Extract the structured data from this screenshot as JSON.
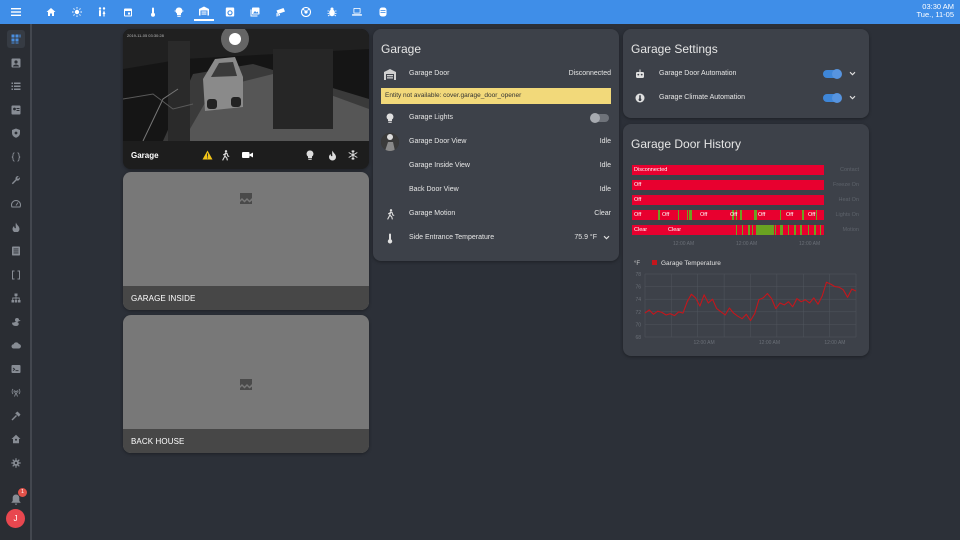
{
  "topbar": {
    "tabs": [
      "home",
      "weather-sunny",
      "human-male-female",
      "calendar",
      "thermometer",
      "lightbulb",
      "garage",
      "washing-machine",
      "image-multiple",
      "cctv",
      "robot-vacuum",
      "bug",
      "laptop",
      "server"
    ],
    "active_tab": 6,
    "time": "03:30 AM",
    "date": "Tue., 11-05"
  },
  "sidebar": {
    "items": [
      "view-dashboard",
      "account-box",
      "format-list",
      "account-card",
      "shield",
      "code-braces",
      "wrench",
      "speedometer",
      "fire",
      "file-list",
      "code-brackets",
      "lan",
      "duck",
      "cloud",
      "console",
      "antenna",
      "hammer",
      "home-assistant",
      "cog"
    ],
    "notifications": "1",
    "user_initial": "J"
  },
  "camera_front": {
    "name": "Garage",
    "timestamp": "2019-11-05 03:30:28"
  },
  "camera_inside": {
    "name": "GARAGE INSIDE"
  },
  "camera_back": {
    "name": "BACK HOUSE"
  },
  "entities": {
    "title": "Garage",
    "rows": [
      {
        "icon": "garage-door",
        "name": "Garage Door",
        "state": "Disconnected"
      },
      {
        "icon": "lightbulb",
        "name": "Garage Lights",
        "state": "off"
      },
      {
        "icon": "camera-thumbnail",
        "name": "Garage Door View",
        "state": "Idle"
      },
      {
        "icon": "none",
        "name": "Garage Inside View",
        "state": "Idle"
      },
      {
        "icon": "none",
        "name": "Back Door View",
        "state": "Idle"
      },
      {
        "icon": "walk",
        "name": "Garage Motion",
        "state": "Clear"
      },
      {
        "icon": "thermometer",
        "name": "Side Entrance Temperature",
        "state": "75.9 °F"
      }
    ],
    "warning": "Entity not available: cover.garage_door_opener"
  },
  "settings": {
    "title": "Garage Settings",
    "rows": [
      {
        "icon": "robot",
        "name": "Garage Door Automation",
        "state": "on"
      },
      {
        "icon": "home-thermometer",
        "name": "Garage Climate Automation",
        "state": "on"
      }
    ]
  },
  "colors": {
    "topbar": "#3f8ee8",
    "card": "#3d4149",
    "background": "#2c3038",
    "toggle_on": "#3f8ee8",
    "timeline_red": "#e8002f",
    "timeline_green": "#6aa321",
    "graph_line": "#c4161c"
  },
  "history": {
    "title": "Garage Door History",
    "timeline": [
      {
        "label": "Disconnected",
        "name": "Contact"
      },
      {
        "label": "Off",
        "name": "Freeze On"
      },
      {
        "label": "Off",
        "name": "Heat On"
      },
      {
        "label": "Off",
        "name": "Lights On",
        "segment_labels": [
          "Off",
          "Off",
          "Off",
          "Off",
          "Off",
          "Off"
        ]
      },
      {
        "label": "Clear",
        "name": "Motion",
        "segment_labels": [
          "Clear",
          "Clear"
        ]
      }
    ],
    "timeline_ticks": [
      "12:00 AM",
      "12:00 AM",
      "12:00 AM"
    ]
  },
  "chart_data": {
    "type": "line",
    "title": "",
    "ylabel": "°F",
    "ylim": [
      68,
      78
    ],
    "yticks": [
      68,
      70,
      72,
      74,
      76,
      78
    ],
    "xticks": [
      "12:00 AM",
      "12:00 AM",
      "12:00 AM"
    ],
    "series": [
      {
        "name": "Garage Temperature",
        "values": [
          71.8,
          72.3,
          71.6,
          72.1,
          71.9,
          71.5,
          71.7,
          71.4,
          72.0,
          71.8,
          73.6,
          74.8,
          74.2,
          72.9,
          74.7,
          73.4,
          74.0,
          72.5,
          72.0,
          71.5,
          72.6,
          71.8,
          71.3,
          70.9,
          71.6,
          70.6,
          71.7,
          73.9,
          74.2,
          74.9,
          74.1,
          72.5,
          73.4,
          73.1,
          73.6,
          72.8,
          74.1,
          73.6,
          73.9,
          73.4,
          74.2,
          73.2,
          74.5,
          76.7,
          76.4,
          76.0,
          75.9,
          75.5,
          74.3,
          75.6,
          75.3
        ]
      }
    ],
    "legend": "top-left",
    "grid": true
  }
}
